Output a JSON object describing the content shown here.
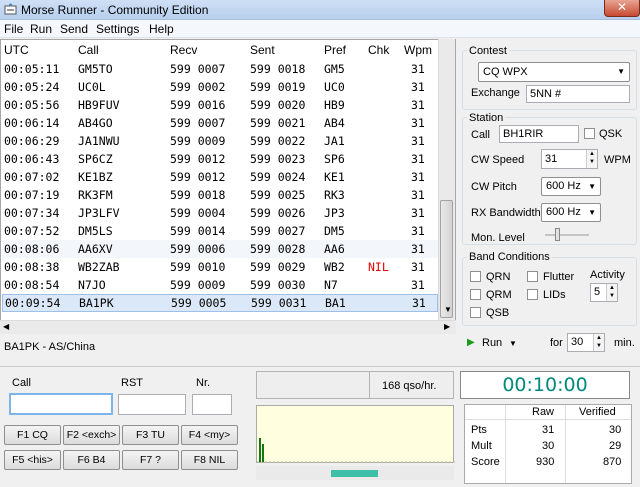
{
  "window": {
    "title": "Morse Runner - Community Edition",
    "close_label": "✕"
  },
  "menu": [
    "File",
    "Run",
    "Send",
    "Settings",
    "Help"
  ],
  "log": {
    "columns": [
      "UTC",
      "Call",
      "Recv",
      "Sent",
      "Pref",
      "Chk",
      "Wpm"
    ],
    "rows": [
      {
        "utc": "00:05:11",
        "call": "GM5TO",
        "recv": "599 0007",
        "sent": "599 0018",
        "pref": "GM5",
        "chk": "",
        "wpm": "31"
      },
      {
        "utc": "00:05:24",
        "call": "UC0L",
        "recv": "599 0002",
        "sent": "599 0019",
        "pref": "UC0",
        "chk": "",
        "wpm": "31"
      },
      {
        "utc": "00:05:56",
        "call": "HB9FUV",
        "recv": "599 0016",
        "sent": "599 0020",
        "pref": "HB9",
        "chk": "",
        "wpm": "31"
      },
      {
        "utc": "00:06:14",
        "call": "AB4GO",
        "recv": "599 0007",
        "sent": "599 0021",
        "pref": "AB4",
        "chk": "",
        "wpm": "31"
      },
      {
        "utc": "00:06:29",
        "call": "JA1NWU",
        "recv": "599 0009",
        "sent": "599 0022",
        "pref": "JA1",
        "chk": "",
        "wpm": "31"
      },
      {
        "utc": "00:06:43",
        "call": "SP6CZ",
        "recv": "599 0012",
        "sent": "599 0023",
        "pref": "SP6",
        "chk": "",
        "wpm": "31"
      },
      {
        "utc": "00:07:02",
        "call": "KE1BZ",
        "recv": "599 0012",
        "sent": "599 0024",
        "pref": "KE1",
        "chk": "",
        "wpm": "31"
      },
      {
        "utc": "00:07:19",
        "call": "RK3FM",
        "recv": "599 0018",
        "sent": "599 0025",
        "pref": "RK3",
        "chk": "",
        "wpm": "31"
      },
      {
        "utc": "00:07:34",
        "call": "JP3LFV",
        "recv": "599 0004",
        "sent": "599 0026",
        "pref": "JP3",
        "chk": "",
        "wpm": "31"
      },
      {
        "utc": "00:07:52",
        "call": "DM5LS",
        "recv": "599 0014",
        "sent": "599 0027",
        "pref": "DM5",
        "chk": "",
        "wpm": "31"
      },
      {
        "utc": "00:08:06",
        "call": "AA6XV",
        "recv": "599 0006",
        "sent": "599 0028",
        "pref": "AA6",
        "chk": "",
        "wpm": "31"
      },
      {
        "utc": "00:08:38",
        "call": "WB2ZAB",
        "recv": "599 0010",
        "sent": "599 0029",
        "pref": "WB2",
        "chk": "NIL",
        "wpm": "31"
      },
      {
        "utc": "00:08:54",
        "call": "N7JO",
        "recv": "599 0009",
        "sent": "599 0030",
        "pref": "N7",
        "chk": "",
        "wpm": "31"
      },
      {
        "utc": "00:09:54",
        "call": "BA1PK",
        "recv": "599 0005",
        "sent": "599 0031",
        "pref": "BA1",
        "chk": "",
        "wpm": "31"
      }
    ]
  },
  "status_line": "BA1PK - AS/China",
  "entry": {
    "call_label": "Call",
    "rst_label": "RST",
    "nr_label": "Nr.",
    "call_value": "",
    "rst_value": "",
    "nr_value": ""
  },
  "fkeys": [
    "F1 CQ",
    "F2 <exch>",
    "F3 TU",
    "F4 <my>",
    "F5 <his>",
    "F6 B4",
    "F7 ?",
    "F8 NIL"
  ],
  "rate": "168 qso/hr.",
  "clock": "00:10:00",
  "score": {
    "headers": [
      "Raw",
      "Verified"
    ],
    "rows": [
      {
        "label": "Pts",
        "raw": "31",
        "verified": "30"
      },
      {
        "label": "Mult",
        "raw": "30",
        "verified": "29"
      },
      {
        "label": "Score",
        "raw": "930",
        "verified": "870"
      }
    ]
  },
  "contest": {
    "group_title": "Contest",
    "selected": "CQ WPX",
    "exchange_label": "Exchange",
    "exchange_value": "5NN #"
  },
  "station": {
    "group_title": "Station",
    "call_label": "Call",
    "call_value": "BH1RIR",
    "qsk_label": "QSK",
    "cw_speed_label": "CW Speed",
    "cw_speed_value": "31",
    "wpm_label": "WPM",
    "cw_pitch_label": "CW Pitch",
    "cw_pitch_value": "600 Hz",
    "rx_bw_label": "RX Bandwidth",
    "rx_bw_value": "600 Hz",
    "mon_level_label": "Mon. Level",
    "mon_level": 0.3
  },
  "band": {
    "group_title": "Band Conditions",
    "qrn": "QRN",
    "qrm": "QRM",
    "qsb": "QSB",
    "flutter": "Flutter",
    "lids": "LIDs",
    "activity_label": "Activity",
    "activity_value": "5"
  },
  "run": {
    "run_label": "Run",
    "for_label": "for",
    "minutes_value": "30",
    "min_label": "min."
  },
  "colors": {
    "nil": "#e00000",
    "clock": "#008a7c",
    "run_arrow": "#1a9a1a",
    "scope_signal": "#107a10"
  }
}
